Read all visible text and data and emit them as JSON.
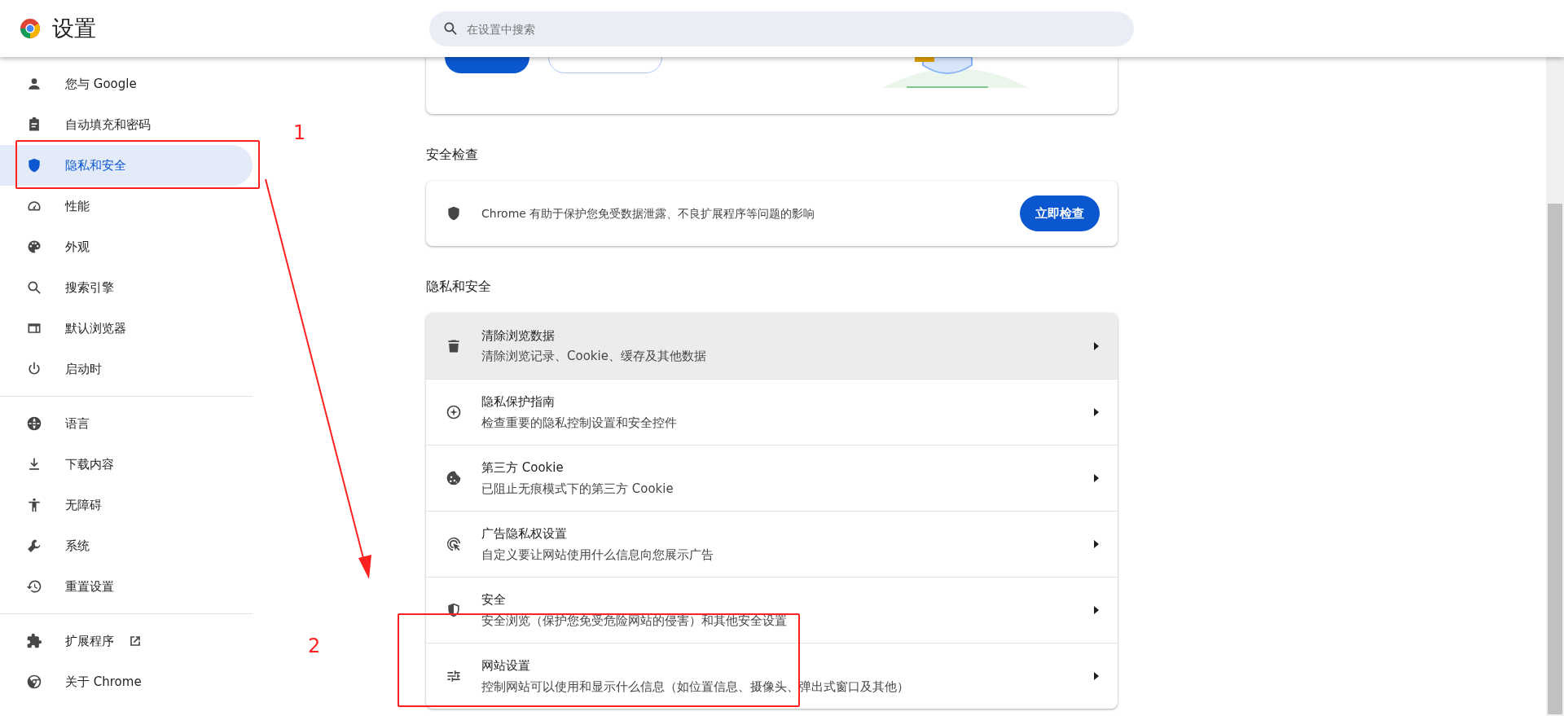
{
  "header": {
    "title": "设置",
    "search": {
      "placeholder": "在设置中搜索"
    }
  },
  "sidebar": {
    "groups": [
      [
        {
          "label": "您与 Google",
          "selected": false
        },
        {
          "label": "自动填充和密码",
          "selected": false
        },
        {
          "label": "隐私和安全",
          "selected": true
        },
        {
          "label": "性能",
          "selected": false
        },
        {
          "label": "外观",
          "selected": false
        },
        {
          "label": "搜索引擎",
          "selected": false
        },
        {
          "label": "默认浏览器",
          "selected": false
        },
        {
          "label": "启动时",
          "selected": false
        }
      ],
      [
        {
          "label": "语言",
          "selected": false
        },
        {
          "label": "下载内容",
          "selected": false
        },
        {
          "label": "无障碍",
          "selected": false
        },
        {
          "label": "系统",
          "selected": false
        },
        {
          "label": "重置设置",
          "selected": false
        }
      ],
      [
        {
          "label": "扩展程序",
          "selected": false,
          "external": true
        },
        {
          "label": "关于 Chrome",
          "selected": false,
          "external": false
        }
      ]
    ]
  },
  "safety_check": {
    "heading": "安全检查",
    "text": "Chrome 有助于保护您免受数据泄露、不良扩展程序等问题的影响",
    "button": "立即检查"
  },
  "privacy": {
    "heading": "隐私和安全",
    "rows": [
      {
        "title": "清除浏览数据",
        "subtitle": "清除浏览记录、Cookie、缓存及其他数据",
        "highlighted": true
      },
      {
        "title": "隐私保护指南",
        "subtitle": "检查重要的隐私控制设置和安全控件",
        "highlighted": false
      },
      {
        "title": "第三方 Cookie",
        "subtitle": "已阻止无痕模式下的第三方 Cookie",
        "highlighted": false
      },
      {
        "title": "广告隐私权设置",
        "subtitle": "自定义要让网站使用什么信息向您展示广告",
        "highlighted": false
      },
      {
        "title": "安全",
        "subtitle": "安全浏览（保护您免受危险网站的侵害）和其他安全设置",
        "highlighted": false
      },
      {
        "title": "网站设置",
        "subtitle": "控制网站可以使用和显示什么信息（如位置信息、摄像头、弹出式窗口及其他）",
        "highlighted": false
      }
    ]
  },
  "annotation_labels": [
    "1",
    "2"
  ]
}
